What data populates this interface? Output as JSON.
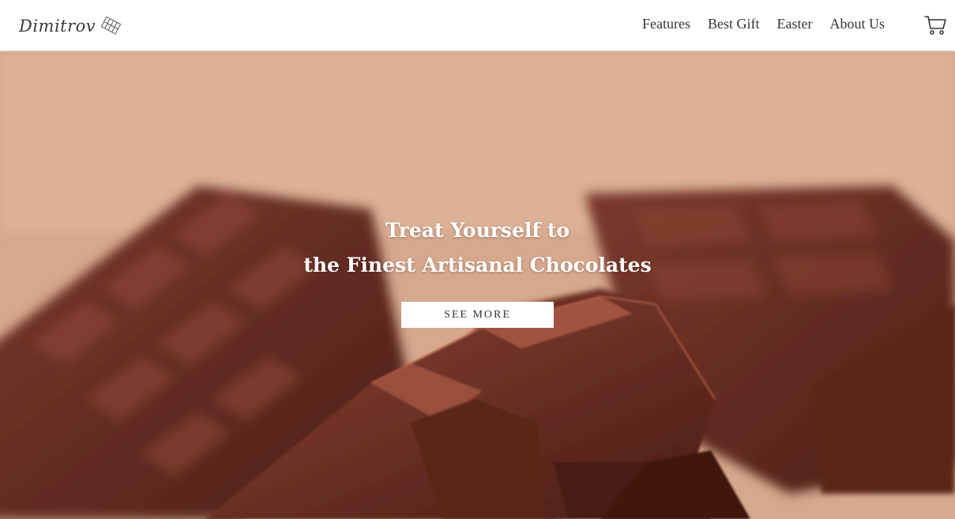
{
  "brand": {
    "name": "Dimitrov",
    "logo_icon": "chocolate-bar-icon"
  },
  "nav": {
    "links": [
      {
        "label": "Features"
      },
      {
        "label": "Best Gift"
      },
      {
        "label": "Easter"
      },
      {
        "label": "About Us"
      }
    ],
    "cart_icon": "shopping-cart-icon"
  },
  "hero": {
    "headline_line1": "Treat Yourself to",
    "headline_line2": "the Finest Artisanal Chocolates",
    "cta_label": "SEE MORE",
    "background_image": "chocolate bars photo"
  },
  "colors": {
    "text": "#333333",
    "hero_bg": "#d1a187",
    "chocolate": "#5e2a1f",
    "white": "#ffffff"
  }
}
